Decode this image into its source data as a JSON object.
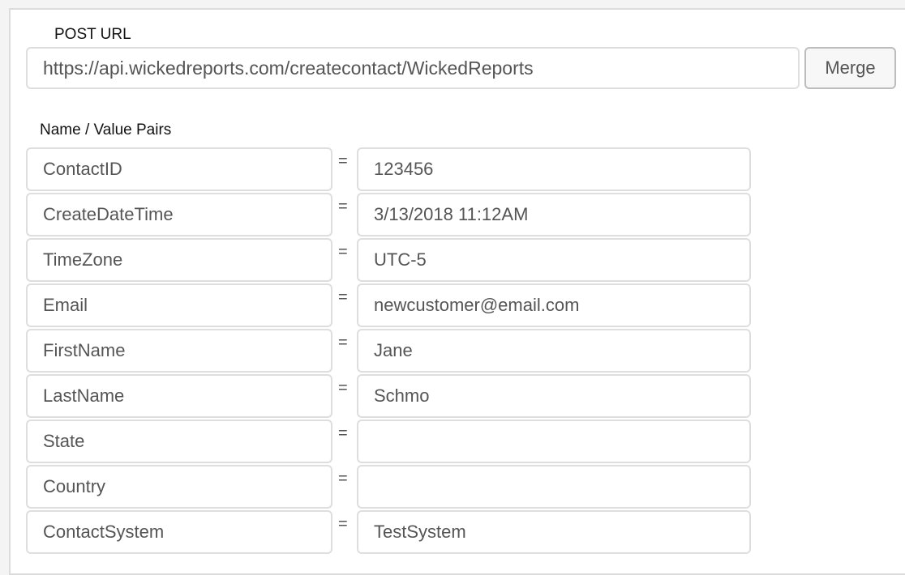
{
  "post_url": {
    "label": "POST URL",
    "value": "https://api.wickedreports.com/createcontact/WickedReports",
    "merge_label": "Merge"
  },
  "pairs_section": {
    "label": "Name / Value Pairs",
    "separator": "=",
    "pairs": [
      {
        "name": "ContactID",
        "value": "123456"
      },
      {
        "name": "CreateDateTime",
        "value": "3/13/2018 11:12AM"
      },
      {
        "name": "TimeZone",
        "value": "UTC-5"
      },
      {
        "name": "Email",
        "value": "newcustomer@email.com"
      },
      {
        "name": "FirstName",
        "value": "Jane"
      },
      {
        "name": "LastName",
        "value": "Schmo"
      },
      {
        "name": "State",
        "value": ""
      },
      {
        "name": "Country",
        "value": ""
      },
      {
        "name": "ContactSystem",
        "value": "TestSystem"
      }
    ]
  }
}
